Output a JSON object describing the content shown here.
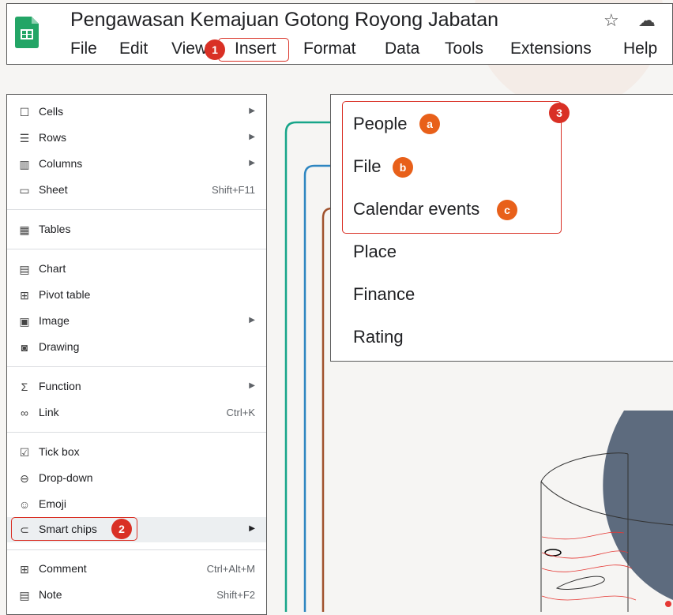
{
  "header": {
    "title": "Pengawasan Kemajuan Gotong Royong Jabatan",
    "menus": [
      "File",
      "Edit",
      "View",
      "Insert",
      "Format",
      "Data",
      "Tools",
      "Extensions",
      "Help"
    ],
    "icons": [
      "star-icon",
      "cloud-status-icon"
    ]
  },
  "badges": {
    "one": "1",
    "two": "2",
    "three": "3",
    "a": "a",
    "b": "b",
    "c": "c"
  },
  "insert_menu": {
    "items": [
      {
        "label": "Cells",
        "icon": "cell-icon",
        "submenu": true
      },
      {
        "label": "Rows",
        "icon": "rows-icon",
        "submenu": true
      },
      {
        "label": "Columns",
        "icon": "columns-icon",
        "submenu": true
      },
      {
        "label": "Sheet",
        "icon": "sheet-icon",
        "shortcut": "Shift+F11"
      },
      {
        "label": "Tables",
        "icon": "table-icon"
      },
      {
        "label": "Chart",
        "icon": "chart-icon"
      },
      {
        "label": "Pivot table",
        "icon": "pivot-table-icon"
      },
      {
        "label": "Image",
        "icon": "image-icon",
        "submenu": true
      },
      {
        "label": "Drawing",
        "icon": "drawing-icon"
      },
      {
        "label": "Function",
        "icon": "sigma-icon",
        "submenu": true
      },
      {
        "label": "Link",
        "icon": "link-icon",
        "shortcut": "Ctrl+K"
      },
      {
        "label": "Tick box",
        "icon": "checkbox-icon"
      },
      {
        "label": "Drop-down",
        "icon": "dropdown-icon"
      },
      {
        "label": "Emoji",
        "icon": "emoji-icon"
      },
      {
        "label": "Smart chips",
        "icon": "smart-chip-icon",
        "submenu": true
      },
      {
        "label": "Comment",
        "icon": "comment-icon",
        "shortcut": "Ctrl+Alt+M"
      },
      {
        "label": "Note",
        "icon": "note-icon",
        "shortcut": "Shift+F2"
      }
    ]
  },
  "smart_chips_menu": {
    "items": [
      "People",
      "File",
      "Calendar events",
      "Place",
      "Finance",
      "Rating"
    ]
  },
  "colors": {
    "highlight": "#d93025",
    "badge_orange": "#e8601a",
    "connector_teal": "#17a589",
    "connector_blue": "#2e86c1",
    "connector_brown": "#a0522d"
  }
}
